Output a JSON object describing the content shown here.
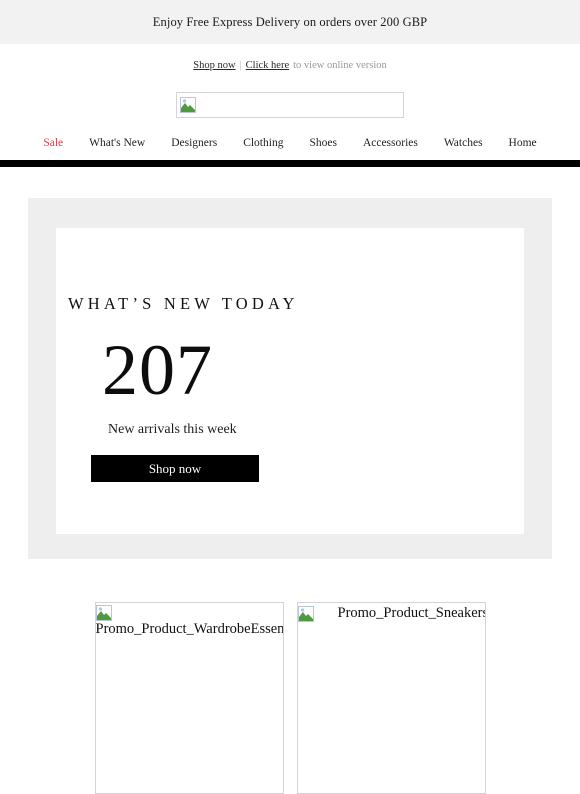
{
  "promo_banner": {
    "text": "Enjoy Free Express Delivery on orders over 200 GBP",
    "background": "#f2f2f2"
  },
  "preheader": {
    "shop_now_label": "Shop now",
    "separator": "|",
    "click_here_label": "Click here",
    "tail_text": "to view online version"
  },
  "logo": {
    "alt": "",
    "icon": "broken-image-icon"
  },
  "nav": {
    "items": [
      {
        "label": "Sale",
        "accent": "#d9424a"
      },
      {
        "label": "What's New"
      },
      {
        "label": "Designers"
      },
      {
        "label": "Clothing"
      },
      {
        "label": "Shoes"
      },
      {
        "label": "Accessories"
      },
      {
        "label": "Watches"
      },
      {
        "label": "Home"
      }
    ],
    "rule_color": "#000000"
  },
  "hero": {
    "title": "WHAT’S NEW TODAY",
    "number": "207",
    "subtitle": "New arrivals this week",
    "cta_label": "Shop now",
    "panel_background": "#eeeeee",
    "card_background": "#ffffff",
    "cta_background": "#000000"
  },
  "products": [
    {
      "alt": "Promo_Product_WardrobeEssentials",
      "icon": "broken-image-icon"
    },
    {
      "alt": "Promo_Product_Sneakers",
      "icon": "broken-image-icon"
    }
  ]
}
